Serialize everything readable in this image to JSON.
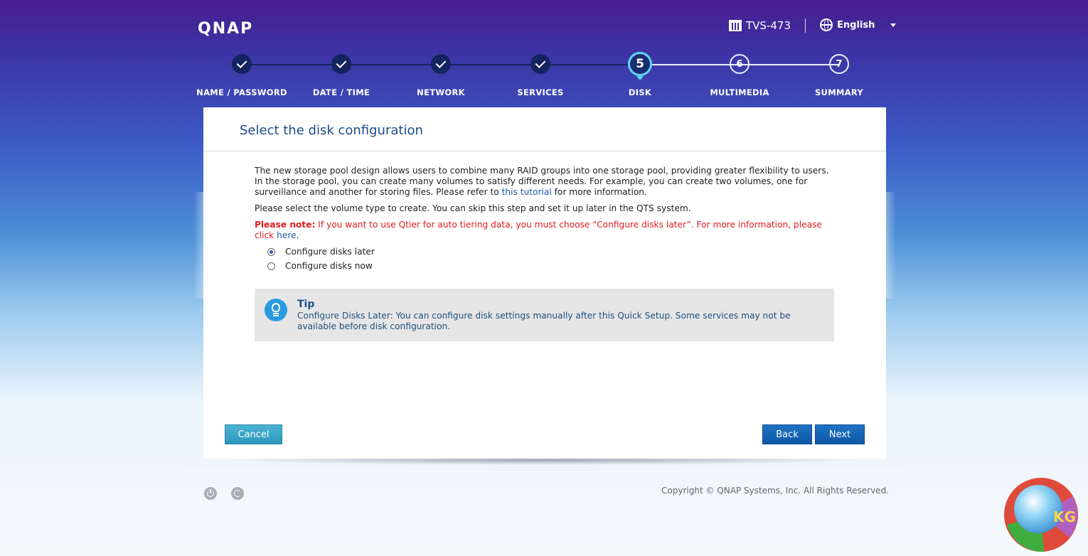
{
  "header": {
    "logo": "QNAP",
    "device_name": "TVS-473",
    "language": "English"
  },
  "steps": [
    {
      "label": "NAME / PASSWORD",
      "state": "done"
    },
    {
      "label": "DATE / TIME",
      "state": "done"
    },
    {
      "label": "NETWORK",
      "state": "done"
    },
    {
      "label": "SERVICES",
      "state": "done"
    },
    {
      "label": "DISK",
      "number": "5",
      "state": "current"
    },
    {
      "label": "MULTIMEDIA",
      "number": "6",
      "state": "todo"
    },
    {
      "label": "SUMMARY",
      "number": "7",
      "state": "todo"
    }
  ],
  "panel": {
    "title": "Select the disk configuration",
    "intro_before_link": "The new storage pool design allows users to combine many RAID groups into one storage pool, providing greater flexibility to users. In the storage pool, you can create many volumes to satisfy different needs. For example, you can create two volumes, one for surveillance and another for storing files. Please refer to ",
    "intro_link": "this tutorial",
    "intro_after_link": " for more information.",
    "select_text": "Please select the volume type to create. You can skip this step and set it up later in the QTS system.",
    "note_label": "Please note:",
    "note_text": " If you want to use Qtier for auto tiering data, you must choose “Configure disks later”. For more information, please click ",
    "note_link": "here",
    "note_end": ".",
    "options": [
      {
        "label": "Configure disks later",
        "selected": true
      },
      {
        "label": "Configure disks now",
        "selected": false
      }
    ],
    "tip": {
      "title": "Tip",
      "text": "Configure Disks Later: You can configure disk settings manually after this Quick Setup. Some services may not be available before disk configuration."
    },
    "buttons": {
      "cancel": "Cancel",
      "back": "Back",
      "next": "Next"
    }
  },
  "footer": {
    "copyright": "Copyright © QNAP Systems, Inc. All Rights Reserved."
  },
  "watermark": {
    "text": "KG"
  },
  "colors": {
    "accent_blue": "#0e57a6",
    "cancel_teal": "#2e98bd",
    "note_red": "#e31b1b",
    "current_step_ring": "#5fd5f0"
  }
}
